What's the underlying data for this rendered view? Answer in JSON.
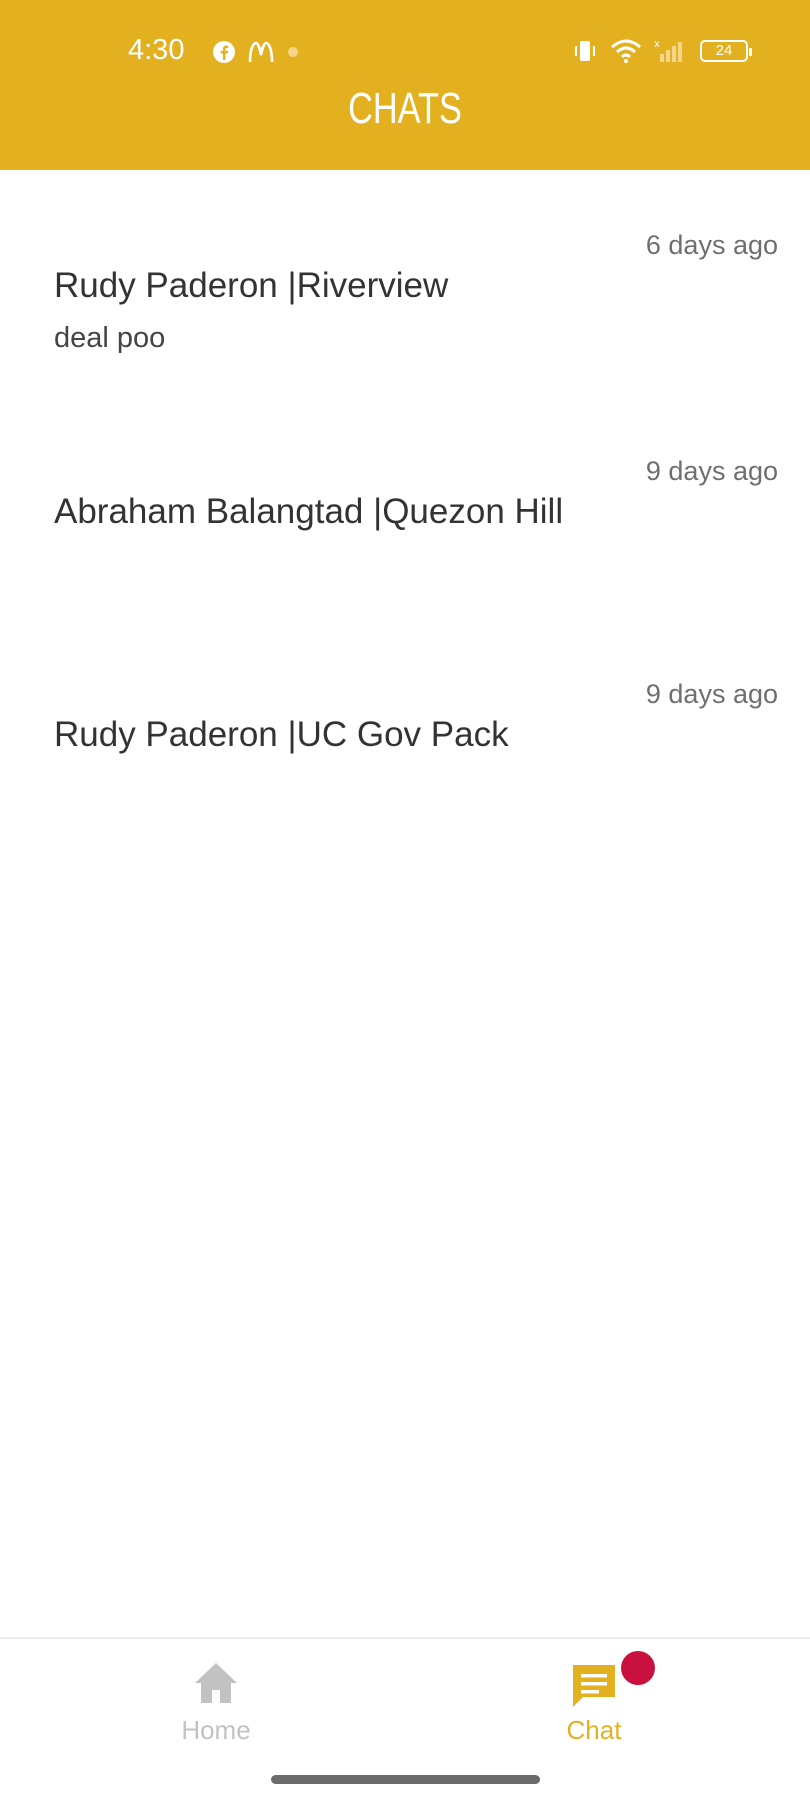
{
  "status_bar": {
    "time": "4:30",
    "battery": "24",
    "left_icons": [
      "facebook-icon",
      "mcdonalds-icon",
      "dot-icon"
    ],
    "right_icons": [
      "vibrate-icon",
      "wifi-icon",
      "signal-icon",
      "battery-icon"
    ]
  },
  "header": {
    "title": "CHATS",
    "color": "#e3b120"
  },
  "chats": [
    {
      "name": "Rudy Paderon |Riverview",
      "preview": "deal poo",
      "time": "6 days ago"
    },
    {
      "name": "Abraham Balangtad |Quezon Hill",
      "preview": "",
      "time": "9 days ago"
    },
    {
      "name": "Rudy Paderon |UC Gov Pack",
      "preview": "",
      "time": "9 days ago"
    }
  ],
  "bottom_nav": {
    "home_label": "Home",
    "chat_label": "Chat",
    "active": "chat",
    "badge_color": "#c8113e"
  }
}
